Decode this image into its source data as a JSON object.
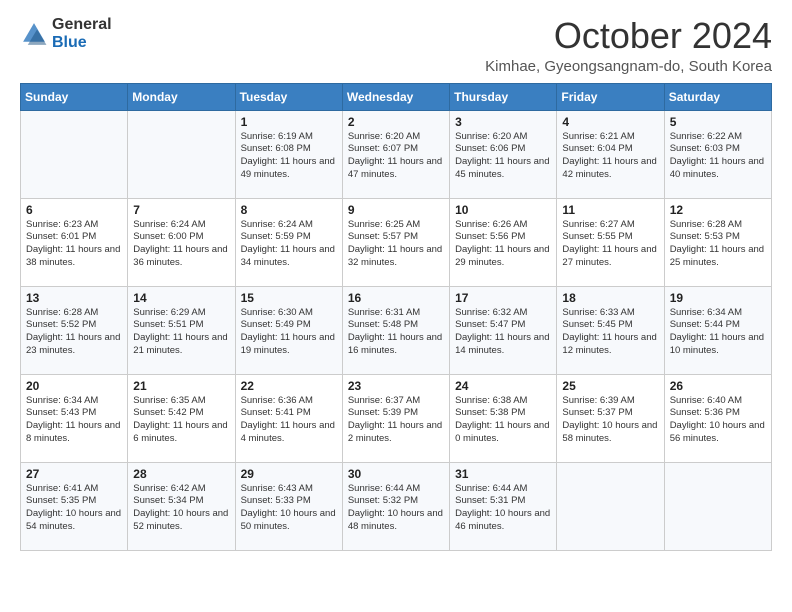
{
  "logo": {
    "general": "General",
    "blue": "Blue"
  },
  "header": {
    "title": "October 2024",
    "subtitle": "Kimhae, Gyeongsangnam-do, South Korea"
  },
  "weekdays": [
    "Sunday",
    "Monday",
    "Tuesday",
    "Wednesday",
    "Thursday",
    "Friday",
    "Saturday"
  ],
  "weeks": [
    [
      {
        "day": "",
        "detail": ""
      },
      {
        "day": "",
        "detail": ""
      },
      {
        "day": "1",
        "detail": "Sunrise: 6:19 AM\nSunset: 6:08 PM\nDaylight: 11 hours\nand 49 minutes."
      },
      {
        "day": "2",
        "detail": "Sunrise: 6:20 AM\nSunset: 6:07 PM\nDaylight: 11 hours\nand 47 minutes."
      },
      {
        "day": "3",
        "detail": "Sunrise: 6:20 AM\nSunset: 6:06 PM\nDaylight: 11 hours\nand 45 minutes."
      },
      {
        "day": "4",
        "detail": "Sunrise: 6:21 AM\nSunset: 6:04 PM\nDaylight: 11 hours\nand 42 minutes."
      },
      {
        "day": "5",
        "detail": "Sunrise: 6:22 AM\nSunset: 6:03 PM\nDaylight: 11 hours\nand 40 minutes."
      }
    ],
    [
      {
        "day": "6",
        "detail": "Sunrise: 6:23 AM\nSunset: 6:01 PM\nDaylight: 11 hours\nand 38 minutes."
      },
      {
        "day": "7",
        "detail": "Sunrise: 6:24 AM\nSunset: 6:00 PM\nDaylight: 11 hours\nand 36 minutes."
      },
      {
        "day": "8",
        "detail": "Sunrise: 6:24 AM\nSunset: 5:59 PM\nDaylight: 11 hours\nand 34 minutes."
      },
      {
        "day": "9",
        "detail": "Sunrise: 6:25 AM\nSunset: 5:57 PM\nDaylight: 11 hours\nand 32 minutes."
      },
      {
        "day": "10",
        "detail": "Sunrise: 6:26 AM\nSunset: 5:56 PM\nDaylight: 11 hours\nand 29 minutes."
      },
      {
        "day": "11",
        "detail": "Sunrise: 6:27 AM\nSunset: 5:55 PM\nDaylight: 11 hours\nand 27 minutes."
      },
      {
        "day": "12",
        "detail": "Sunrise: 6:28 AM\nSunset: 5:53 PM\nDaylight: 11 hours\nand 25 minutes."
      }
    ],
    [
      {
        "day": "13",
        "detail": "Sunrise: 6:28 AM\nSunset: 5:52 PM\nDaylight: 11 hours\nand 23 minutes."
      },
      {
        "day": "14",
        "detail": "Sunrise: 6:29 AM\nSunset: 5:51 PM\nDaylight: 11 hours\nand 21 minutes."
      },
      {
        "day": "15",
        "detail": "Sunrise: 6:30 AM\nSunset: 5:49 PM\nDaylight: 11 hours\nand 19 minutes."
      },
      {
        "day": "16",
        "detail": "Sunrise: 6:31 AM\nSunset: 5:48 PM\nDaylight: 11 hours\nand 16 minutes."
      },
      {
        "day": "17",
        "detail": "Sunrise: 6:32 AM\nSunset: 5:47 PM\nDaylight: 11 hours\nand 14 minutes."
      },
      {
        "day": "18",
        "detail": "Sunrise: 6:33 AM\nSunset: 5:45 PM\nDaylight: 11 hours\nand 12 minutes."
      },
      {
        "day": "19",
        "detail": "Sunrise: 6:34 AM\nSunset: 5:44 PM\nDaylight: 11 hours\nand 10 minutes."
      }
    ],
    [
      {
        "day": "20",
        "detail": "Sunrise: 6:34 AM\nSunset: 5:43 PM\nDaylight: 11 hours\nand 8 minutes."
      },
      {
        "day": "21",
        "detail": "Sunrise: 6:35 AM\nSunset: 5:42 PM\nDaylight: 11 hours\nand 6 minutes."
      },
      {
        "day": "22",
        "detail": "Sunrise: 6:36 AM\nSunset: 5:41 PM\nDaylight: 11 hours\nand 4 minutes."
      },
      {
        "day": "23",
        "detail": "Sunrise: 6:37 AM\nSunset: 5:39 PM\nDaylight: 11 hours\nand 2 minutes."
      },
      {
        "day": "24",
        "detail": "Sunrise: 6:38 AM\nSunset: 5:38 PM\nDaylight: 11 hours\nand 0 minutes."
      },
      {
        "day": "25",
        "detail": "Sunrise: 6:39 AM\nSunset: 5:37 PM\nDaylight: 10 hours\nand 58 minutes."
      },
      {
        "day": "26",
        "detail": "Sunrise: 6:40 AM\nSunset: 5:36 PM\nDaylight: 10 hours\nand 56 minutes."
      }
    ],
    [
      {
        "day": "27",
        "detail": "Sunrise: 6:41 AM\nSunset: 5:35 PM\nDaylight: 10 hours\nand 54 minutes."
      },
      {
        "day": "28",
        "detail": "Sunrise: 6:42 AM\nSunset: 5:34 PM\nDaylight: 10 hours\nand 52 minutes."
      },
      {
        "day": "29",
        "detail": "Sunrise: 6:43 AM\nSunset: 5:33 PM\nDaylight: 10 hours\nand 50 minutes."
      },
      {
        "day": "30",
        "detail": "Sunrise: 6:44 AM\nSunset: 5:32 PM\nDaylight: 10 hours\nand 48 minutes."
      },
      {
        "day": "31",
        "detail": "Sunrise: 6:44 AM\nSunset: 5:31 PM\nDaylight: 10 hours\nand 46 minutes."
      },
      {
        "day": "",
        "detail": ""
      },
      {
        "day": "",
        "detail": ""
      }
    ]
  ]
}
